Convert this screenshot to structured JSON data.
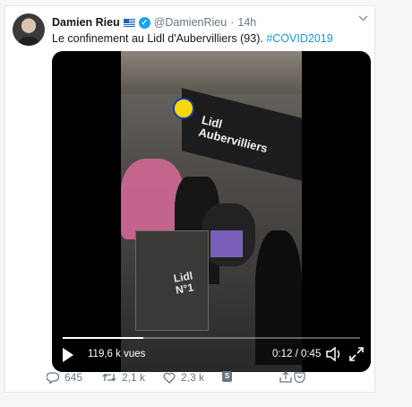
{
  "tweet": {
    "author_name": "Damien Rieu",
    "handle": "@DamienRieu",
    "separator": "·",
    "time": "14h",
    "text_main": "Le confinement au Lidl d'Aubervilliers (93). ",
    "hashtag": "#COVID2019"
  },
  "video": {
    "sign_line1": "Lidl",
    "sign_line2": "Aubervilliers",
    "counter_line1": "Lidl",
    "counter_line2": "N°1",
    "views": "119,6 k vues",
    "timecode": "0:12 / 0:45",
    "progress": 0.27
  },
  "actions": {
    "replies": "645",
    "retweets": "2,1 k",
    "likes": "2,3 k",
    "stats_icon_label": "S"
  },
  "colors": {
    "accent": "#1da1f2",
    "hashtag": "#1b95e0",
    "muted": "#657786"
  }
}
